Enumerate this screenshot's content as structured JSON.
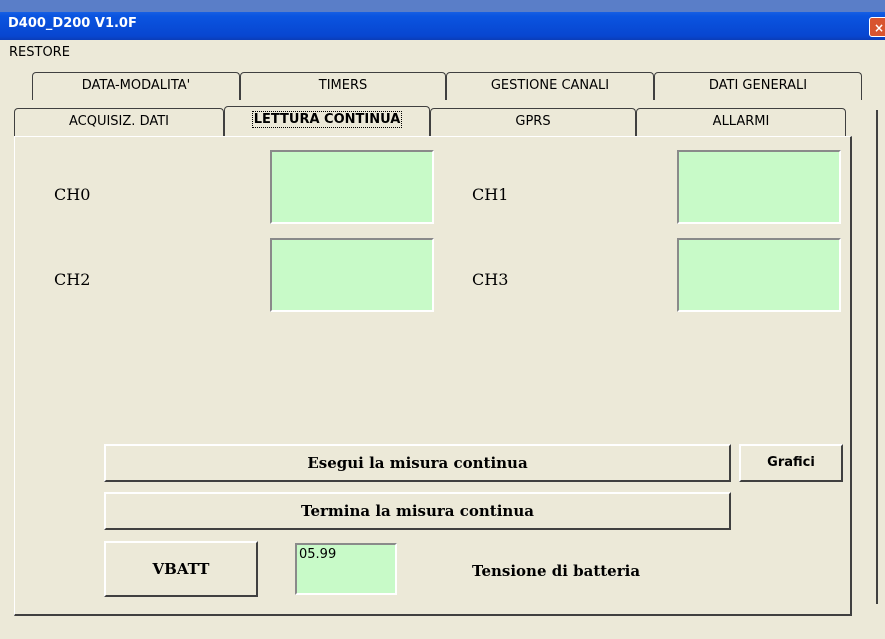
{
  "window": {
    "title": "D400_D200 V1.0F",
    "close_glyph": "×"
  },
  "menu": {
    "items": [
      "RESTORE"
    ]
  },
  "tabs": {
    "row1": [
      "DATA-MODALITA'",
      "TIMERS",
      "GESTIONE CANALI",
      "DATI GENERALI"
    ],
    "row2": [
      "ACQUISIZ. DATI",
      "LETTURA CONTINUA",
      "GPRS",
      "ALLARMI"
    ],
    "active": "LETTURA CONTINUA"
  },
  "channels": {
    "ch0": {
      "label": "CH0",
      "value": ""
    },
    "ch1": {
      "label": "CH1",
      "value": ""
    },
    "ch2": {
      "label": "CH2",
      "value": ""
    },
    "ch3": {
      "label": "CH3",
      "value": ""
    }
  },
  "buttons": {
    "start": "Esegui la misura continua",
    "stop": "Termina la misura continua",
    "charts": "Grafici",
    "vbatt": "VBATT"
  },
  "battery": {
    "value": "05.99",
    "description": "Tensione di batteria"
  },
  "colors": {
    "field_bg": "#c8fac8",
    "window_bg": "#ece9d8",
    "titlebar": "#0a54e0"
  }
}
